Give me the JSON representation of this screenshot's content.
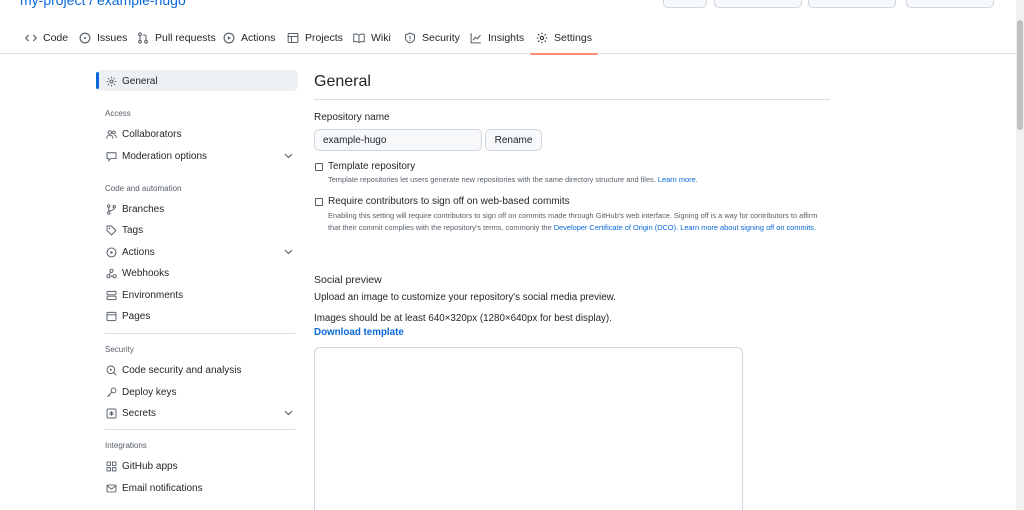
{
  "header": {
    "repo_path": "my-project / example-hugo"
  },
  "repo_nav": [
    {
      "label": "Code",
      "icon": "code-icon"
    },
    {
      "label": "Issues",
      "icon": "issue-icon"
    },
    {
      "label": "Pull requests",
      "icon": "pull-request-icon"
    },
    {
      "label": "Actions",
      "icon": "play-icon"
    },
    {
      "label": "Projects",
      "icon": "table-icon"
    },
    {
      "label": "Wiki",
      "icon": "book-icon"
    },
    {
      "label": "Security",
      "icon": "shield-icon"
    },
    {
      "label": "Insights",
      "icon": "graph-icon"
    },
    {
      "label": "Settings",
      "icon": "gear-icon",
      "active": true
    }
  ],
  "sidebar": {
    "general": "General",
    "access_heading": "Access",
    "collaborators": "Collaborators",
    "moderation": "Moderation options",
    "code_heading": "Code and automation",
    "branches": "Branches",
    "tags": "Tags",
    "actions": "Actions",
    "webhooks": "Webhooks",
    "environments": "Environments",
    "pages": "Pages",
    "security_heading": "Security",
    "code_security": "Code security and analysis",
    "deploy_keys": "Deploy keys",
    "secrets": "Secrets",
    "integrations_heading": "Integrations",
    "github_apps": "GitHub apps",
    "email_notifications": "Email notifications"
  },
  "main": {
    "title": "General",
    "repo_name_label": "Repository name",
    "repo_name_value": "example-hugo",
    "rename_button": "Rename",
    "template_label": "Template repository",
    "template_note": "Template repositories let users generate new repositories with the same directory structure and files.",
    "template_learn_more": "Learn more.",
    "signoff_label": "Require contributors to sign off on web-based commits",
    "signoff_note": "Enabling this setting will require contributors to sign off on commits made through GitHub's web interface. Signing off is a way for contributors to affirm that their commit complies with the repository's terms, commonly the",
    "signoff_dco_link": "Developer Certificate of Origin (DCO).",
    "signoff_learn_more": "Learn more about signing off on commits.",
    "social_preview_title": "Social preview",
    "social_preview_desc": "Upload an image to customize your repository's social media preview.",
    "social_preview_size": "Images should be at least 640×320px (1280×640px for best display).",
    "download_template": "Download template"
  },
  "colors": {
    "accent": "#0969da",
    "active_tab_underline": "#fd8c73"
  }
}
